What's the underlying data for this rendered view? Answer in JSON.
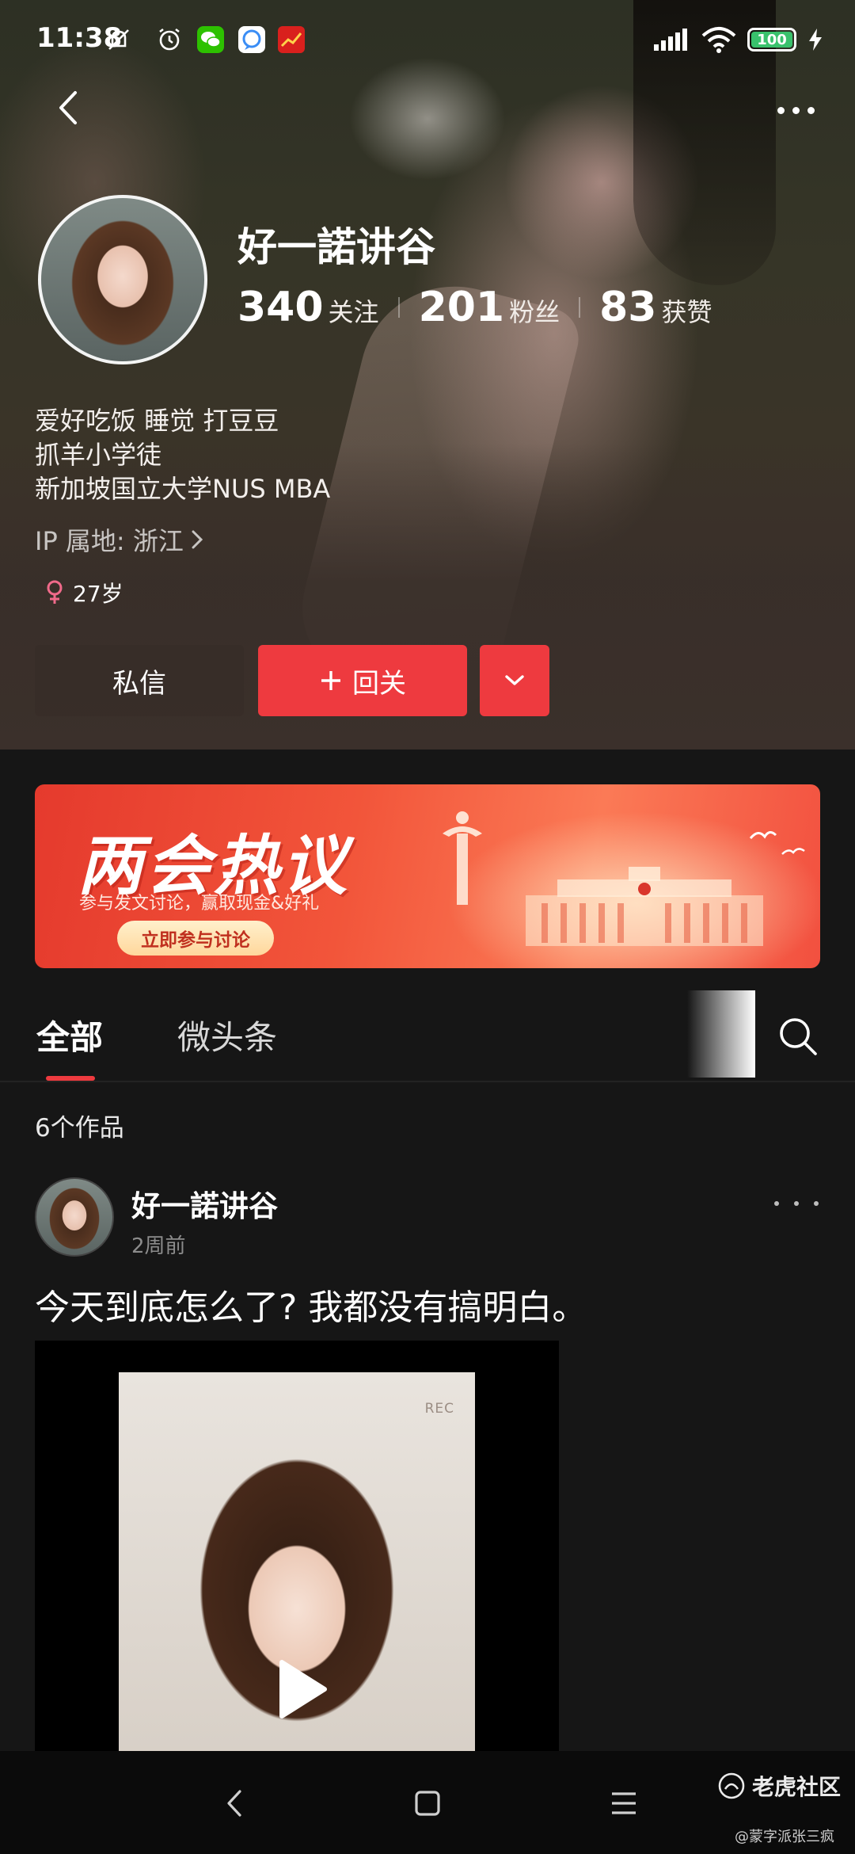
{
  "status_bar": {
    "time": "11:38",
    "battery": "100",
    "battery_level": 1.0,
    "left_icons": [
      "mute-icon",
      "alarm-icon",
      "wechat-icon",
      "chat-bubble-icon",
      "news-app-icon"
    ],
    "right_icons": [
      "signal-icon",
      "wifi-icon",
      "battery-icon",
      "charging-icon"
    ]
  },
  "profile": {
    "name": "好一諾讲谷",
    "stats": [
      {
        "value": "340",
        "label": "关注"
      },
      {
        "value": "201",
        "label": "粉丝"
      },
      {
        "value": "83",
        "label": "获赞"
      }
    ],
    "bio": [
      "爱好吃饭 睡觉 打豆豆",
      "抓羊小学徒",
      "新加坡国立大学NUS MBA"
    ],
    "ip_location": "IP 属地: 浙江",
    "age": "27岁",
    "gender_icon": "female-icon"
  },
  "actions": {
    "message": "私信",
    "follow_back": "回关"
  },
  "banner": {
    "title": "两会热议",
    "subtitle": "参与发文讨论，赢取现金&好礼",
    "cta": "立即参与讨论"
  },
  "tabs": [
    {
      "label": "全部",
      "active": true
    },
    {
      "label": "微头条",
      "active": false
    }
  ],
  "feed": {
    "works_count": "6个作品",
    "post": {
      "author": "好一諾讲谷",
      "time": "2周前",
      "text": "今天到底怎么了? 我都没有搞明白。",
      "video_label": "REC"
    }
  },
  "watermark": {
    "site": "老虎社区",
    "handle": "@蒙字派张三疯"
  },
  "colors": {
    "accent": "#ee3a3f",
    "background": "#161616",
    "battery": "#39c16c"
  }
}
